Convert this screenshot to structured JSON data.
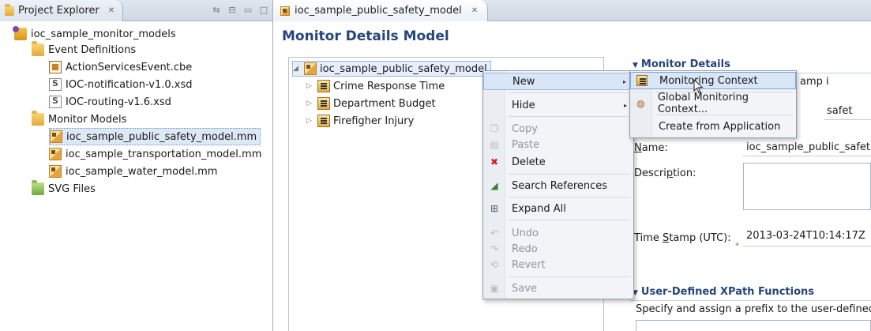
{
  "explorer": {
    "tab_label": "Project Explorer",
    "close_glyph": "✕",
    "tree": [
      {
        "label": "ioc_sample_monitor_models",
        "icon": "project-icon"
      },
      {
        "label": "Event Definitions",
        "icon": "folder-icon"
      },
      {
        "label": "ActionServicesEvent.cbe",
        "icon": "cbe-file-icon"
      },
      {
        "label": "IOC-notification-v1.0.xsd",
        "icon": "xsd-file-icon"
      },
      {
        "label": "IOC-routing-v1.6.xsd",
        "icon": "xsd-file-icon"
      },
      {
        "label": "Monitor Models",
        "icon": "folder-icon"
      },
      {
        "label": "ioc_sample_public_safety_model.mm",
        "icon": "monitor-model-icon",
        "selected": true
      },
      {
        "label": "ioc_sample_transportation_model.mm",
        "icon": "monitor-model-icon"
      },
      {
        "label": "ioc_sample_water_model.mm",
        "icon": "monitor-model-icon"
      },
      {
        "label": "SVG Files",
        "icon": "svg-folder-icon"
      }
    ]
  },
  "editor": {
    "tab_label": "ioc_sample_public_safety_model",
    "close_glyph": "✕",
    "title": "Monitor Details Model",
    "model_tree": {
      "root": "ioc_sample_public_safety_model",
      "children": [
        "Crime Response Time",
        "Department Budget",
        "Firefigher Injury"
      ]
    },
    "details": {
      "monitor_header": "Monitor Details",
      "partial_text_1": "amp i",
      "partial_text_2": "safet",
      "name_label_pre": "",
      "name_label_u": "N",
      "name_label_post": "ame:",
      "name_value": "ioc_sample_public_safet",
      "description_label_pre": "Descri",
      "description_label_u": "p",
      "description_label_post": "tion:",
      "timestamp_label_pre": "Time ",
      "timestamp_label_u": "S",
      "timestamp_label_post": "tamp (UTC):",
      "timestamp_value": "2013-03-24T10:14:17Z",
      "required_marker": "*",
      "xpath_header": "User-Defined XPath Functions",
      "xpath_desc": "Specify and assign a prefix to the user-defined"
    }
  },
  "context_menu": {
    "items": [
      {
        "label": "New",
        "submenu": true,
        "enabled": true
      },
      {
        "label": "Hide",
        "submenu": true,
        "enabled": true
      },
      {
        "label": "Copy",
        "enabled": false
      },
      {
        "label": "Paste",
        "enabled": false
      },
      {
        "label": "Delete",
        "enabled": true
      },
      {
        "label": "Search References",
        "enabled": true
      },
      {
        "label": "Expand All",
        "enabled": true
      },
      {
        "label": "Undo",
        "enabled": false
      },
      {
        "label": "Redo",
        "enabled": false
      },
      {
        "label": "Revert",
        "enabled": false
      },
      {
        "label": "Save",
        "enabled": false
      }
    ],
    "submenu": [
      {
        "label": "Monitoring Context"
      },
      {
        "label": "Global Monitoring Context..."
      },
      {
        "label": "Create from Application"
      }
    ],
    "arrow": "▸"
  },
  "colors": {
    "title_blue": "#26457a",
    "selection_bg": "#dde8f5",
    "menu_bg": "#f2f4f7",
    "delete_red": "#cc2222"
  }
}
